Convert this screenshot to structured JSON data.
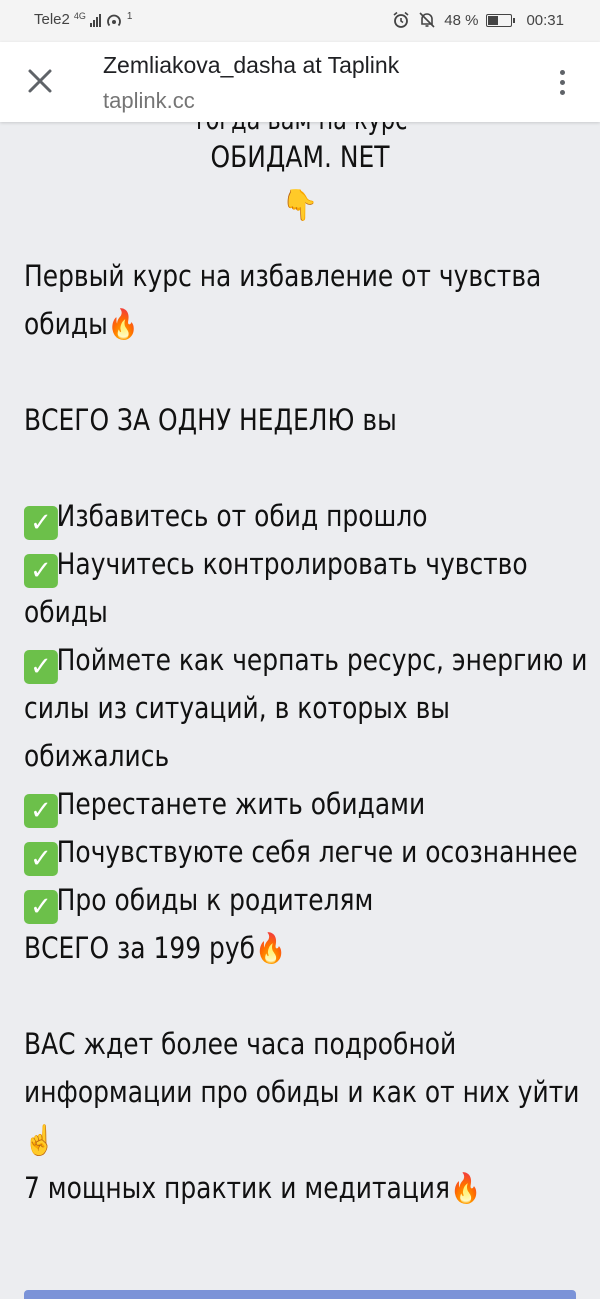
{
  "status_bar": {
    "carrier": "Tele2",
    "network": "4G",
    "hotspot_count": "1",
    "battery_percent": "48 %",
    "battery_level": 0.48,
    "time": "00:31"
  },
  "browser": {
    "title": "Zemliakova_dasha at Taplink",
    "url": "taplink.cc"
  },
  "content": {
    "heading_partial": "тогда вам на курс",
    "heading": "ОБИДАМ. NET",
    "heading_emoji": "👇",
    "lines": [
      {
        "check": false,
        "text": "Первый курс на избавление от чувства"
      },
      {
        "check": false,
        "text": "обиды🔥"
      },
      {
        "check": false,
        "text": ""
      },
      {
        "check": false,
        "text": "ВСЕГО ЗА ОДНУ НЕДЕЛЮ вы"
      },
      {
        "check": false,
        "text": ""
      },
      {
        "check": true,
        "text": "Избавитесь от обид прошло"
      },
      {
        "check": true,
        "text": "Научитесь контролировать чувство"
      },
      {
        "check": false,
        "text": "обиды"
      },
      {
        "check": true,
        "text": "Поймете как черпать ресурс, энергию и"
      },
      {
        "check": false,
        "text": "силы из ситуаций, в которых вы"
      },
      {
        "check": false,
        "text": "обижались"
      },
      {
        "check": true,
        "text": "Перестанете жить обидами"
      },
      {
        "check": true,
        "text": "Почувствуюте себя легче и осознаннее"
      },
      {
        "check": true,
        "text": "Про обиды к родителям"
      },
      {
        "check": false,
        "text": "ВСЕГО за 199 руб🔥"
      },
      {
        "check": false,
        "text": ""
      },
      {
        "check": false,
        "text": "ВАС ждет более часа подробной"
      },
      {
        "check": false,
        "text": "информации про обиды и как от них уйти"
      },
      {
        "check": false,
        "text": "☝️"
      },
      {
        "check": false,
        "text": "7 мощных практик и медитация🔥"
      }
    ],
    "check_mark": "✓"
  },
  "colors": {
    "page_bg": "#ecedf0",
    "check_bg": "#6cc04a",
    "button_bg": "#7b93d8"
  }
}
